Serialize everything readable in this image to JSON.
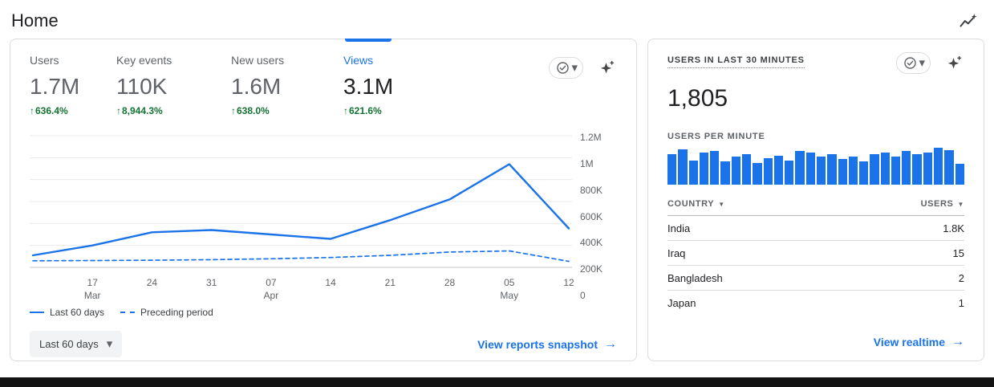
{
  "page": {
    "title": "Home",
    "accent": "#1a73e8"
  },
  "icons": {
    "caret_down": "▾",
    "sort_caret": "▼",
    "up_arrow": "↑",
    "forward_arrow": "→"
  },
  "overview_card": {
    "tabs": [
      {
        "label": "Users",
        "value": "1.7M",
        "delta": "636.4%"
      },
      {
        "label": "Key events",
        "value": "110K",
        "delta": "8,944.3%"
      },
      {
        "label": "New users",
        "value": "1.6M",
        "delta": "638.0%"
      },
      {
        "label": "Views",
        "value": "3.1M",
        "delta": "621.6%"
      }
    ],
    "selected_tab": "Views",
    "date_range_button": "Last 60 days",
    "snapshot_link": "View reports snapshot"
  },
  "chart_data": [
    {
      "id": "views-trend",
      "type": "line",
      "title": "Views",
      "y_ticks": [
        "1.2M",
        "1M",
        "800K",
        "600K",
        "400K",
        "200K",
        "0"
      ],
      "ylim_thousands": [
        0,
        1200
      ],
      "x_ticks": [
        {
          "day": "17",
          "month": "Mar"
        },
        {
          "day": "24",
          "month": ""
        },
        {
          "day": "31",
          "month": ""
        },
        {
          "day": "07",
          "month": "Apr"
        },
        {
          "day": "14",
          "month": ""
        },
        {
          "day": "21",
          "month": ""
        },
        {
          "day": "28",
          "month": ""
        },
        {
          "day": "05",
          "month": "May"
        },
        {
          "day": "12",
          "month": ""
        }
      ],
      "grid": true,
      "legend_position": "bottom-left",
      "line_color": "#1a73e8",
      "series": [
        {
          "name": "Last 60 days",
          "style": "solid",
          "unit": "thousands",
          "values": [
            110,
            200,
            320,
            340,
            300,
            260,
            430,
            620,
            940,
            355
          ]
        },
        {
          "name": "Preceding period",
          "style": "dashed",
          "unit": "thousands",
          "values": [
            60,
            62,
            65,
            70,
            78,
            90,
            110,
            140,
            150,
            55
          ]
        }
      ]
    },
    {
      "id": "users-per-minute",
      "type": "bar",
      "title": "USERS PER MINUTE",
      "bar_color": "#1a73e8",
      "values_percent": [
        82,
        96,
        66,
        88,
        92,
        62,
        76,
        82,
        58,
        72,
        78,
        66,
        92,
        86,
        76,
        82,
        70,
        76,
        64,
        82,
        88,
        76,
        92,
        82,
        88,
        100,
        94,
        56
      ]
    }
  ],
  "realtime_card": {
    "title": "USERS IN LAST 30 MINUTES",
    "users_count": "1,805",
    "per_minute_label": "USERS PER MINUTE",
    "table": {
      "columns": [
        "COUNTRY",
        "USERS"
      ],
      "rows": [
        {
          "country": "India",
          "users": "1.8K"
        },
        {
          "country": "Iraq",
          "users": "15"
        },
        {
          "country": "Bangladesh",
          "users": "2"
        },
        {
          "country": "Japan",
          "users": "1"
        }
      ]
    },
    "realtime_link": "View realtime"
  }
}
